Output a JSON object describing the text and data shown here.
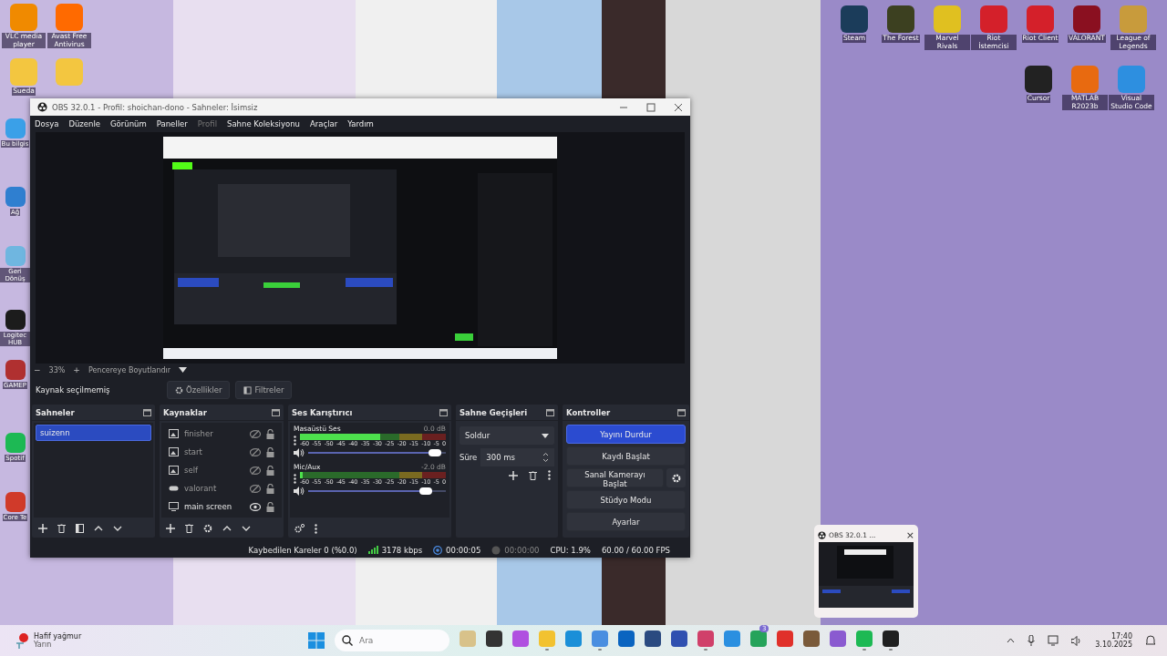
{
  "desktop_left": [
    {
      "label": "VLC media player",
      "color": "#f08a00"
    },
    {
      "label": "Avast Free Antivirus",
      "color": "#ff6a00"
    },
    {
      "label": "Sueda",
      "color": "#f3c640"
    },
    {
      "color": "#f3c640"
    }
  ],
  "desktop_edge": [
    {
      "label": "Bu bilgis",
      "color": "#3aa0e8"
    },
    {
      "label": "Ağ",
      "color": "#2f7fd0"
    },
    {
      "label": "Geri Dönüş",
      "color": "#6fb6e0"
    },
    {
      "label": "Logitec HUB",
      "color": "#1c1c1c"
    },
    {
      "label": "GAMEP",
      "color": "#b03030"
    },
    {
      "label": "Spotif",
      "color": "#1db954"
    },
    {
      "label": "Core Te",
      "color": "#d03a2a"
    }
  ],
  "desktop_top_right": [
    {
      "label": "Steam",
      "color": "#1b3c5a"
    },
    {
      "label": "The Forest",
      "color": "#3c4020"
    },
    {
      "label": "Marvel Rivals",
      "color": "#e0c020"
    },
    {
      "label": "Riot İstemcisi",
      "color": "#d4202a"
    },
    {
      "label": "Riot Client",
      "color": "#d4202a"
    },
    {
      "label": "VALORANT",
      "color": "#8a1020"
    },
    {
      "label": "League of Legends",
      "color": "#c89b3c"
    }
  ],
  "desktop_second_row": [
    {
      "label": "Cursor",
      "color": "#222222"
    },
    {
      "label": "MATLAB R2023b",
      "color": "#e86a10"
    },
    {
      "label": "Visual Studio Code",
      "color": "#2d8fe0"
    }
  ],
  "obs": {
    "title": "OBS 32.0.1 - Profil: shoichan-dono - Sahneler: İsimsiz",
    "menu": [
      {
        "label": "Dosya",
        "disabled": false
      },
      {
        "label": "Düzenle",
        "disabled": false
      },
      {
        "label": "Görünüm",
        "disabled": false
      },
      {
        "label": "Paneller",
        "disabled": false
      },
      {
        "label": "Profil",
        "disabled": true
      },
      {
        "label": "Sahne Koleksiyonu",
        "disabled": false
      },
      {
        "label": "Araçlar",
        "disabled": false
      },
      {
        "label": "Yardım",
        "disabled": false
      }
    ],
    "zoom": {
      "minus": "−",
      "value": "33%",
      "plus": "+",
      "fit": "Pencereye Boyutlandır"
    },
    "source_bar": {
      "status": "Kaynak seçilmemiş",
      "properties": "Özellikler",
      "filters": "Filtreler"
    },
    "scenes": {
      "title": "Sahneler",
      "items": [
        {
          "label": "suizenn",
          "selected": true
        }
      ]
    },
    "sources": {
      "title": "Kaynaklar",
      "items": [
        {
          "label": "finisher",
          "kind": "image",
          "visible": false,
          "locked": false
        },
        {
          "label": "start",
          "kind": "image",
          "visible": false,
          "locked": false
        },
        {
          "label": "self",
          "kind": "image",
          "visible": false,
          "locked": false
        },
        {
          "label": "valorant",
          "kind": "game",
          "visible": false,
          "locked": false
        },
        {
          "label": "main screen",
          "kind": "display",
          "visible": true,
          "locked": false
        }
      ]
    },
    "mixer": {
      "title": "Ses Karıştırıcı",
      "channels": [
        {
          "name": "Masaüstü Ses",
          "reading": "0.0 dB",
          "meter": {
            "level": 0.55
          },
          "volume": {
            "level": 0.97
          },
          "ticks": [
            "-60",
            "-55",
            "-50",
            "-45",
            "-40",
            "-35",
            "-30",
            "-25",
            "-20",
            "-15",
            "-10",
            "-5",
            "0"
          ]
        },
        {
          "name": "Mic/Aux",
          "reading": "-2.0 dB",
          "meter": {
            "level": 0.02
          },
          "volume": {
            "level": 0.9
          },
          "ticks": [
            "-60",
            "-55",
            "-50",
            "-45",
            "-40",
            "-35",
            "-30",
            "-25",
            "-20",
            "-15",
            "-10",
            "-5",
            "0"
          ]
        }
      ]
    },
    "transitions": {
      "title": "Sahne Geçişleri",
      "type": "Soldur",
      "duration_label": "Süre",
      "duration": "300 ms"
    },
    "controls": {
      "title": "Kontroller",
      "buttons": [
        {
          "label": "Yayını Durdur",
          "active": true,
          "has_settings": false
        },
        {
          "label": "Kaydı Başlat",
          "active": false,
          "has_settings": false
        },
        {
          "label": "Sanal Kamerayı Başlat",
          "active": false,
          "has_settings": true
        },
        {
          "label": "Stüdyo Modu",
          "active": false,
          "has_settings": false
        },
        {
          "label": "Ayarlar",
          "active": false,
          "has_settings": false
        }
      ]
    },
    "status_bar": {
      "dropped": "Kaybedilen Kareler 0 (%0.0)",
      "bitrate": "3178 kbps",
      "stream_time": "00:00:05",
      "record_time": "00:00:00",
      "cpu": "CPU: 1.9%",
      "fps": "60.00 / 60.00 FPS"
    }
  },
  "taskbar_preview": {
    "title": "OBS 32.0.1 ...",
    "close": "×"
  },
  "taskbar": {
    "weather": {
      "condition": "Hafif yağmur",
      "when": "Yarın"
    },
    "search": {
      "placeholder": "Ara"
    },
    "apps": [
      {
        "color": "#d8c28a",
        "running": false
      },
      {
        "color": "#333333",
        "running": false
      },
      {
        "color": "#b050e0",
        "running": false
      },
      {
        "color": "#f2c230",
        "running": true
      },
      {
        "color": "#1a8fd8",
        "running": false
      },
      {
        "color": "#4a8ee0",
        "running": true
      },
      {
        "color": "#0a64c0",
        "running": false
      },
      {
        "color": "#2a4a80",
        "running": false
      },
      {
        "color": "#3050b0",
        "running": false
      },
      {
        "color": "#d0406a",
        "running": true
      },
      {
        "color": "#2a8fe0",
        "running": false
      },
      {
        "color": "#25a35a",
        "running": false,
        "badge": "3"
      },
      {
        "color": "#e0302a",
        "running": false
      },
      {
        "color": "#7a5a3a",
        "running": false
      },
      {
        "color": "#8a5ad0",
        "running": false
      },
      {
        "color": "#1db954",
        "running": true
      },
      {
        "color": "#202020",
        "running": true
      }
    ],
    "time": "17:40",
    "date": "3.10.2025"
  }
}
